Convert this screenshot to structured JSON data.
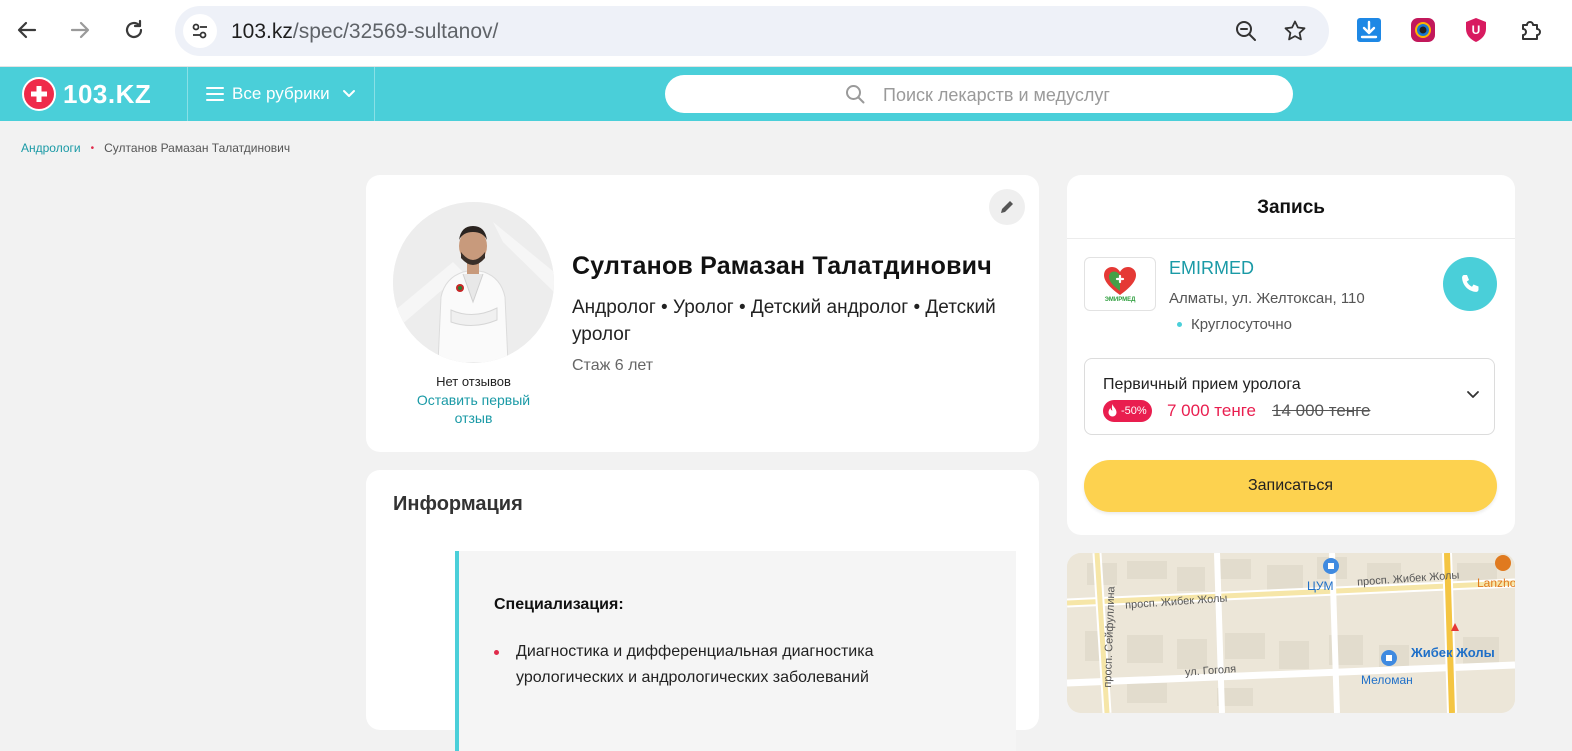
{
  "browser": {
    "url_host": "103.kz",
    "url_path": "/spec/32569-sultanov/"
  },
  "header": {
    "logo_text": "103.KZ",
    "rubrics_label": "Все рубрики",
    "search_placeholder": "Поиск лекарств и медуслуг"
  },
  "breadcrumb": {
    "parent": "Андрологи",
    "separator": "•",
    "current": "Султанов Рамазан Талатдинович"
  },
  "profile": {
    "name": "Султанов Рамазан Талатдинович",
    "specialties": "Андролог • Уролог • Детский андролог • Детский уролог",
    "experience": "Стаж 6 лет",
    "reviews_status": "Нет отзывов",
    "review_link": "Оставить первый отзыв"
  },
  "info": {
    "title": "Информация",
    "spec_heading": "Специализация:",
    "spec_items": [
      "Диагностика и дифференциальная диагностика урологических и андрологических заболеваний"
    ]
  },
  "booking": {
    "title": "Запись",
    "clinic_name": "EMIRMED",
    "clinic_logo_caption": "ЭМИРМЕД",
    "clinic_address": "Алматы, ул. Желтоксан, 110",
    "clinic_hours": "Круглосуточно",
    "service_name": "Первичный прием уролога",
    "discount": "-50%",
    "price_new": "7 000 тенге",
    "price_old": "14 000 тенге",
    "book_button": "Записаться"
  },
  "map": {
    "labels": {
      "street1": "просп. Жибек Жолы",
      "street2": "просп. Жибек Жолы",
      "street3": "просп. Сейфуллина",
      "street4": "ул. Гоголя",
      "poi1": "ЦУМ",
      "poi2": "Меломан",
      "metro": "Жибек Жолы",
      "orange": "Lanzho"
    }
  },
  "colors": {
    "accent": "#4acfd9",
    "brand_red": "#ef2b4a",
    "price_red": "#e91e4f",
    "button_yellow": "#fdd24f",
    "link": "#1a9aa6"
  }
}
